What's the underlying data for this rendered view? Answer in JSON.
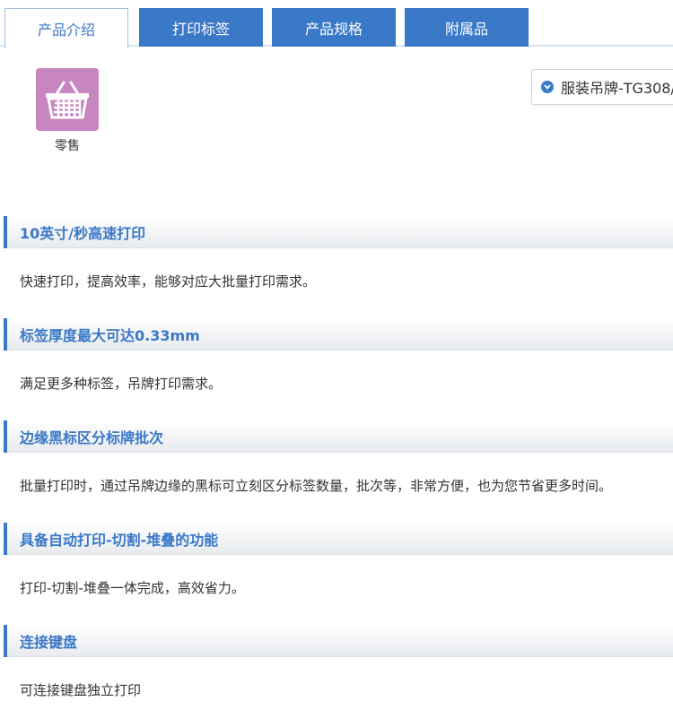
{
  "tabs": [
    {
      "label": "产品介绍",
      "active": true
    },
    {
      "label": "打印标签",
      "active": false
    },
    {
      "label": "产品规格",
      "active": false
    },
    {
      "label": "附属品",
      "active": false
    }
  ],
  "category": {
    "icon": "shopping-basket-icon",
    "label": "零售",
    "color": "#c786c0"
  },
  "dropdown": {
    "icon": "chevron-down-circle-icon",
    "value": "服装吊牌-TG308/"
  },
  "accent_color": "#3a78c8",
  "sections": [
    {
      "title": "10英寸/秒高速打印",
      "body": "快速打印，提高效率，能够对应大批量打印需求。"
    },
    {
      "title": "标签厚度最大可达0.33mm",
      "body": "满足更多种标签，吊牌打印需求。"
    },
    {
      "title": "边缘黑标区分标牌批次",
      "body": "批量打印时，通过吊牌边缘的黑标可立刻区分标签数量，批次等，非常方便，也为您节省更多时间。"
    },
    {
      "title": "具备自动打印-切割-堆叠的功能",
      "body": "打印-切割-堆叠一体完成，高效省力。"
    },
    {
      "title": "连接键盘",
      "body": "可连接键盘独立打印"
    }
  ]
}
